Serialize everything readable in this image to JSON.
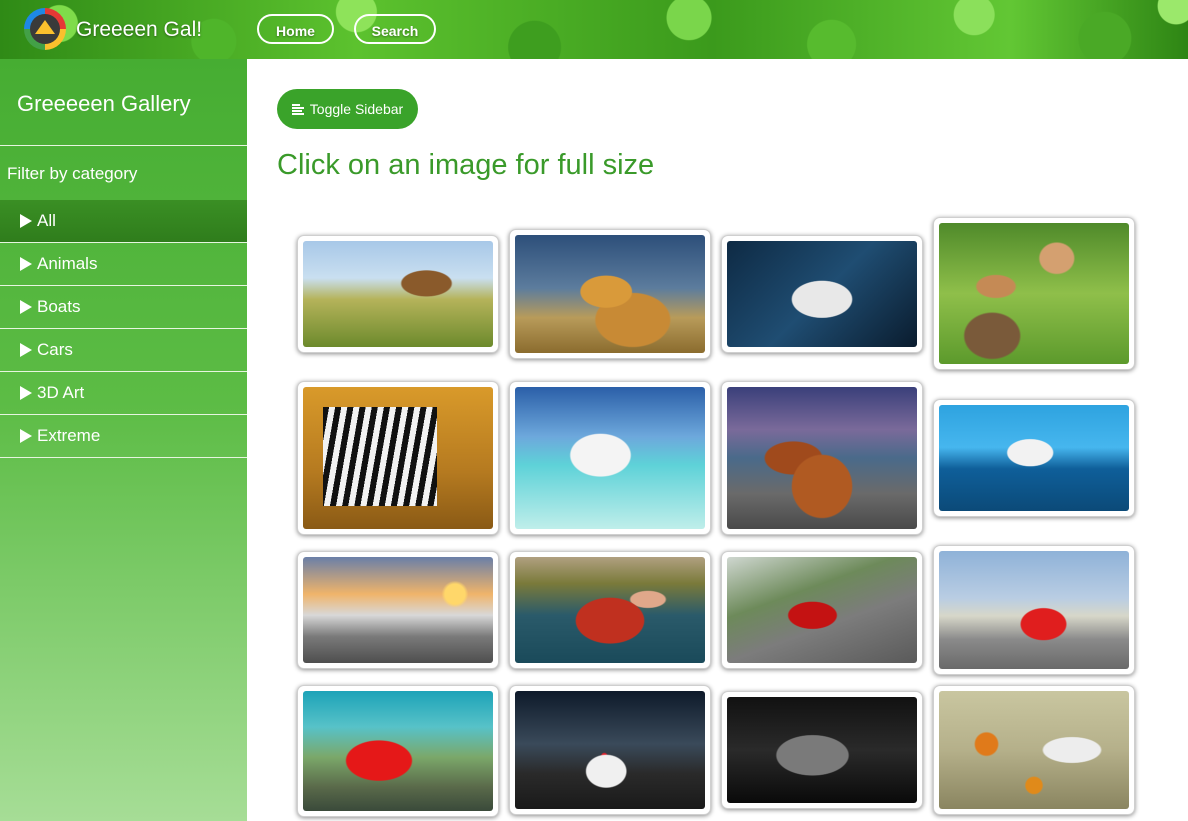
{
  "header": {
    "brand": "Greeeen Gal!",
    "nav": [
      {
        "label": "Home"
      },
      {
        "label": "Search"
      }
    ]
  },
  "sidebar": {
    "title": "Greeeeen Gallery",
    "filter_label": "Filter by category",
    "items": [
      {
        "label": "All",
        "active": true
      },
      {
        "label": "Animals",
        "active": false
      },
      {
        "label": "Boats",
        "active": false
      },
      {
        "label": "Cars",
        "active": false
      },
      {
        "label": "3D Art",
        "active": false
      },
      {
        "label": "Extreme",
        "active": false
      }
    ]
  },
  "main": {
    "toggle_label": "Toggle Sidebar",
    "heading": "Click on an image for full size"
  },
  "gallery": {
    "images": [
      {
        "subject": "giraffes"
      },
      {
        "subject": "lion"
      },
      {
        "subject": "snow leopard"
      },
      {
        "subject": "kittens"
      },
      {
        "subject": "zebras"
      },
      {
        "subject": "speedboat"
      },
      {
        "subject": "rowboats"
      },
      {
        "subject": "floating pod"
      },
      {
        "subject": "kayaks"
      },
      {
        "subject": "man in boat"
      },
      {
        "subject": "red sports car on road"
      },
      {
        "subject": "red bmw"
      },
      {
        "subject": "red ferrari"
      },
      {
        "subject": "police car"
      },
      {
        "subject": "black muscle car"
      },
      {
        "subject": "3d art face with flowers"
      }
    ]
  },
  "colors": {
    "accent": "#3aa32a",
    "heading": "#3a9a2a",
    "sidebar_top": "#46ad32",
    "sidebar_bottom": "#a6dd96",
    "active_item": "#2f7d1c"
  }
}
